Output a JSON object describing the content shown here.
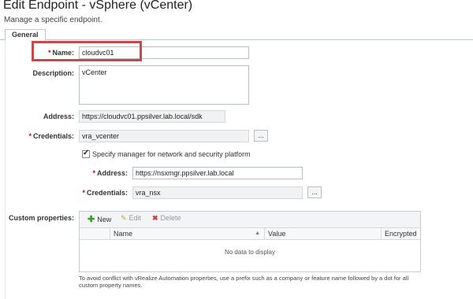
{
  "page": {
    "title": "Edit Endpoint - vSphere (vCenter)",
    "subtitle": "Manage a specific endpoint."
  },
  "tabs": [
    {
      "label": "General",
      "active": true
    }
  ],
  "form": {
    "required_mark": "*",
    "name": {
      "label": "Name:",
      "value": "cloudvc01",
      "required": true
    },
    "description": {
      "label": "Description:",
      "value": "vCenter"
    },
    "address": {
      "label": "Address:",
      "value": "https://cloudvc01.ppsilver.lab.local/sdk",
      "readonly": true
    },
    "credentials": {
      "label": "Credentials:",
      "value": "vra_vcenter",
      "button_label": "...",
      "required": true
    },
    "nsx_checkbox": {
      "label": "Specify manager for network and security platform",
      "checked": true
    },
    "nsx_address": {
      "label": "Address:",
      "value": "https://nsxmgr.ppsilver.lab.local",
      "required": true
    },
    "nsx_credentials": {
      "label": "Credentials:",
      "value": "vra_nsx",
      "button_label": "...",
      "required": true
    },
    "custom_properties": {
      "label": "Custom properties:",
      "toolbar": {
        "new_label": "New",
        "edit_label": "Edit",
        "delete_label": "Delete"
      },
      "columns": [
        "Name",
        "Value",
        "Encrypted"
      ],
      "empty_text": "No data to display",
      "help_text": "To avoid conflict with vRealize Automation properties, use a prefix such as a company or feature name followed by a dot for all custom property names."
    }
  },
  "colors": {
    "highlight": "#c9484a",
    "required": "#d0021b",
    "add_icon": "#3a9a2c",
    "delete_icon": "#d04040"
  }
}
